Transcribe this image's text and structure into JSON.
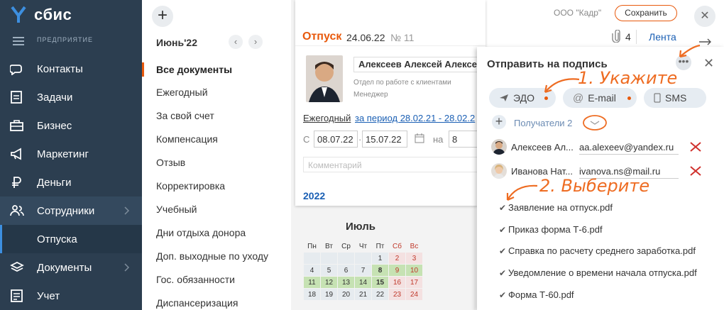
{
  "app": {
    "logo_text": "сбис",
    "company": "ПРЕДПРИЯТИЕ"
  },
  "nav": [
    {
      "label": "Контакты",
      "icon": "contacts-icon"
    },
    {
      "label": "Задачи",
      "icon": "tasks-icon"
    },
    {
      "label": "Бизнес",
      "icon": "business-icon"
    },
    {
      "label": "Маркетинг",
      "icon": "megaphone-icon"
    },
    {
      "label": "Деньги",
      "icon": "ruble-icon"
    },
    {
      "label": "Сотрудники",
      "icon": "employees-icon"
    },
    {
      "label": "Отпуска",
      "icon": ""
    },
    {
      "label": "Документы",
      "icon": "documents-icon"
    },
    {
      "label": "Учет",
      "icon": "accounting-icon"
    }
  ],
  "list": {
    "month": "Июнь'22",
    "items": [
      "Все документы",
      "Ежегодный",
      "За свой счет",
      "Компенсация",
      "Отзыв",
      "Корректировка",
      "Учебный",
      "Дни отдыха донора",
      "Доп. выходные по уходу",
      "Гос. обязанности",
      "Диспансеризация"
    ]
  },
  "doc": {
    "title": "Отпуск",
    "date": "24.06.22",
    "number": "№ 11",
    "attachments": "4",
    "feed": "Лента",
    "employee": "Алексеев Алексей Алексе",
    "department": "Отдел по работе с клиентами",
    "position": "Менеджер",
    "type": "Ежегодный",
    "period": "за период 28.02.21 - 28.02.2",
    "from_label": "С",
    "date_from": "08.07.22",
    "date_to": "15.07.22",
    "on_label": "на",
    "days": "8",
    "comment_placeholder": "Комментарий",
    "year": "2022",
    "cal_month": "Июль",
    "weekdays": [
      "Пн",
      "Вт",
      "Ср",
      "Чт",
      "Пт",
      "Сб",
      "Вс"
    ],
    "cal_rows": [
      [
        "",
        "",
        "",
        "",
        "1",
        "2",
        "3"
      ],
      [
        "4",
        "5",
        "6",
        "7",
        "8",
        "9",
        "10"
      ],
      [
        "11",
        "12",
        "13",
        "14",
        "15",
        "16",
        "17"
      ],
      [
        "18",
        "19",
        "20",
        "21",
        "22",
        "23",
        "24"
      ]
    ]
  },
  "header": {
    "org": "ООО \"Кадр\"",
    "save": "Сохранить"
  },
  "panel": {
    "title": "Отправить на подпись",
    "channels": [
      "ЭДО",
      "E-mail",
      "SMS"
    ],
    "recipients_label": "Получатели 2",
    "recipients": [
      {
        "name": "Алексеев Ал...",
        "email": "aa.alexeev@yandex.ru"
      },
      {
        "name": "Иванова Нат...",
        "email": "ivanova.ns@mail.ru"
      }
    ],
    "files": [
      "Заявление на отпуск.pdf",
      "Приказ форма Т-6.pdf",
      "Справка по расчету среднего заработка.pdf",
      "Уведомление о времени начала отпуска.pdf",
      "Форма Т-60.pdf"
    ],
    "note1": "1. Укажите",
    "note2": "2. Выберите"
  },
  "colors": {
    "accent": "#e8590c",
    "sidebar": "#2c3e50",
    "link": "#1a5fb4"
  }
}
